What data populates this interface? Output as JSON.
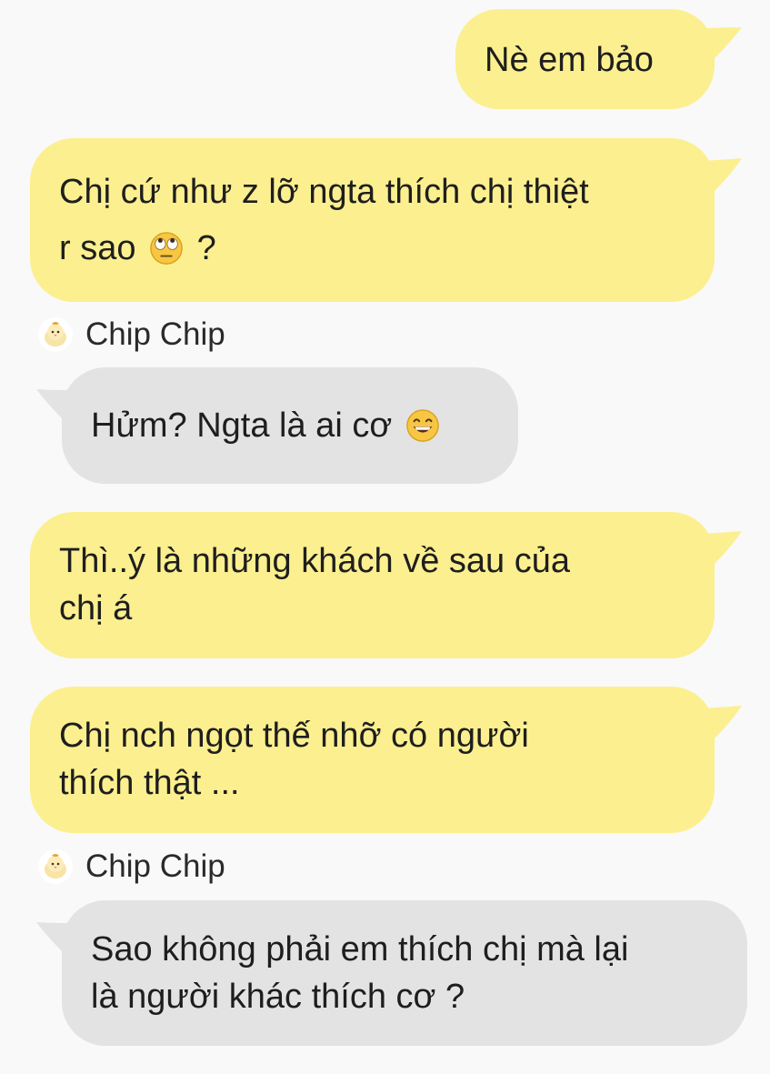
{
  "messages": [
    {
      "side": "me",
      "text": "Nè em bảo"
    },
    {
      "side": "me",
      "text": "Chị cứ như z lỡ ngta thích chị thiệt",
      "line2_text": "r sao",
      "line2_emoji": "face-with-rolling-eyes-icon",
      "line2_after": "?"
    },
    {
      "side": "them",
      "sender": "Chip Chip",
      "text": "Hửm? Ngta là ai cơ",
      "emoji": "grinning-face-icon"
    },
    {
      "side": "me",
      "text": "Thì..ý là những khách về sau của\nchị á"
    },
    {
      "side": "me",
      "text": "Chị nch ngọt thế nhỡ có người\nthích thật ..."
    },
    {
      "side": "them",
      "sender": "Chip Chip",
      "text": "Sao không phải em thích chị mà lại\nlà người khác thích cơ ?"
    }
  ],
  "colors": {
    "background": "#f9f9f9",
    "my_bubble": "#fcef8f",
    "their_bubble": "#e3e3e3",
    "text": "#1e1e1e"
  },
  "avatar_icon": "chick-avatar-icon"
}
